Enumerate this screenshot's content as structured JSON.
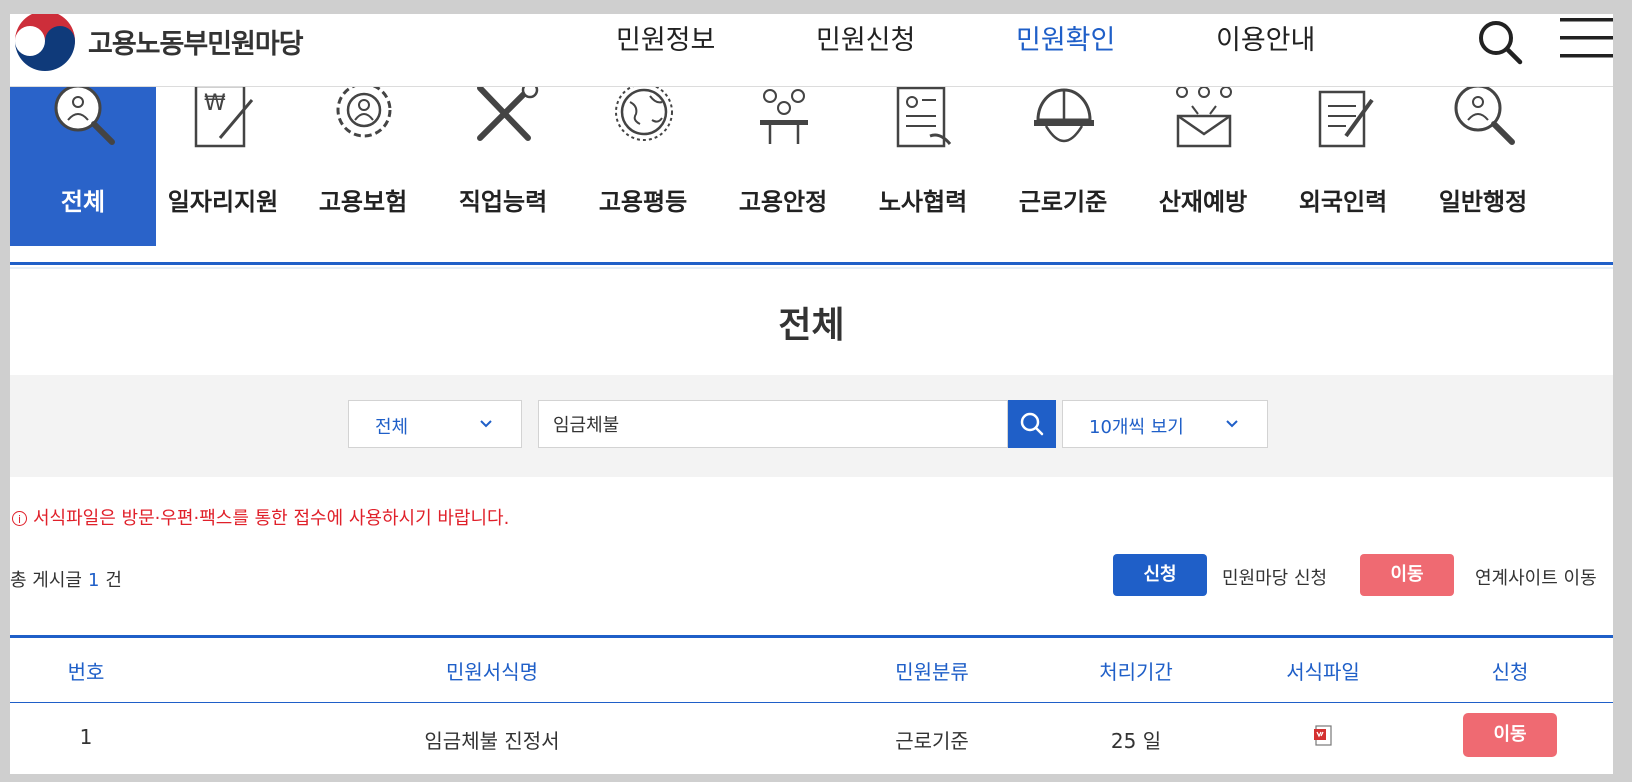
{
  "header": {
    "brand": "고용노동부민원마당",
    "nav": [
      {
        "label": "민원정보",
        "active": false
      },
      {
        "label": "민원신청",
        "active": false
      },
      {
        "label": "민원확인",
        "active": true
      },
      {
        "label": "이용안내",
        "active": false
      }
    ],
    "search_icon": "search-icon",
    "menu_icon": "hamburger-menu-icon"
  },
  "categories": [
    {
      "label": "전체",
      "icon": "person-magnifier-icon",
      "active": true
    },
    {
      "label": "일자리지원",
      "icon": "won-document-pen-icon",
      "active": false
    },
    {
      "label": "고용보험",
      "icon": "gear-person-icon",
      "active": false
    },
    {
      "label": "직업능력",
      "icon": "tools-icon",
      "active": false
    },
    {
      "label": "고용평등",
      "icon": "globe-icon",
      "active": false
    },
    {
      "label": "고용안정",
      "icon": "meeting-icon",
      "active": false
    },
    {
      "label": "노사협력",
      "icon": "contract-hand-icon",
      "active": false
    },
    {
      "label": "근로기준",
      "icon": "helmet-icon",
      "active": false
    },
    {
      "label": "산재예방",
      "icon": "group-envelope-icon",
      "active": false
    },
    {
      "label": "외국인력",
      "icon": "document-pen-icon",
      "active": false
    },
    {
      "label": "일반행정",
      "icon": "person-magnifier-icon",
      "active": false
    }
  ],
  "page_title": "전체",
  "search": {
    "category_select": "전체",
    "keyword": "임금체불",
    "page_size_select": "10개씩 보기"
  },
  "notice": "서식파일은 방문·우편·팩스를 통한 접수에 사용하시기 바랍니다.",
  "total": {
    "prefix": "총 게시글",
    "count": "1",
    "suffix": "건"
  },
  "legend": {
    "apply_button": "신청",
    "apply_text": "민원마당 신청",
    "move_button": "이동",
    "move_text": "연계사이트 이동"
  },
  "table": {
    "headers": [
      "번호",
      "민원서식명",
      "민원분류",
      "처리기간",
      "서식파일",
      "신청"
    ],
    "rows": [
      {
        "no": "1",
        "name": "임금체불 진정서",
        "category": "근로기준",
        "period": "25 일",
        "file_icon": "hwp-file-icon",
        "action": "이동"
      }
    ]
  },
  "colors": {
    "accent": "#1f5fc8",
    "move": "#ef6a72",
    "notice": "#e0202a"
  }
}
